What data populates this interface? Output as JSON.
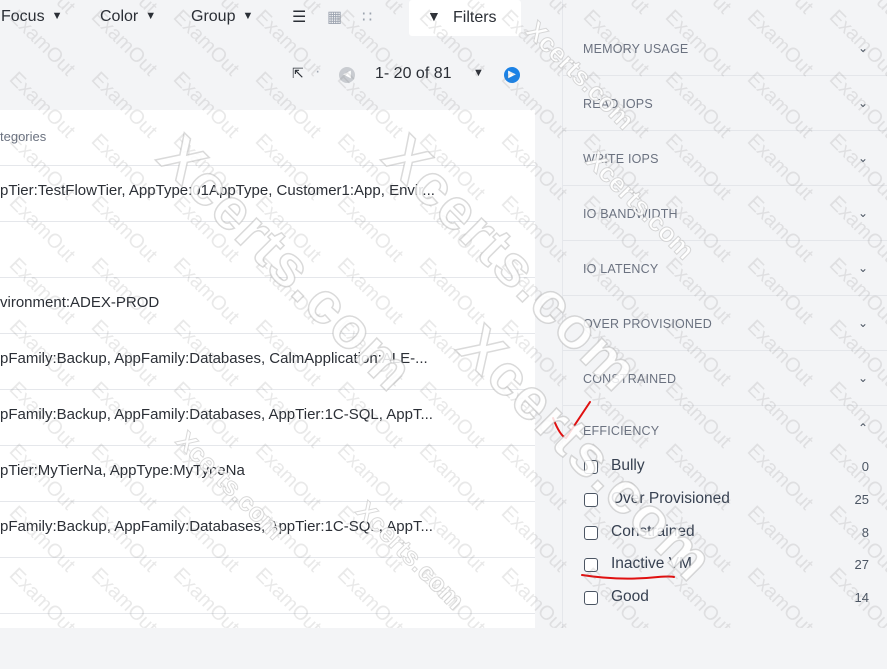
{
  "toolbar": {
    "focus_label": "Focus",
    "color_label": "Color",
    "group_label": "Group",
    "filters_label": "Filters"
  },
  "pagination": {
    "range_label": "1- 20 of 81"
  },
  "table": {
    "column_header": "tegories",
    "rows": [
      "pTier:TestFlowTier, AppType:01AppType, Customer1:App, Envir...",
      "",
      "vironment:ADEX-PROD",
      "pFamily:Backup, AppFamily:Databases, CalmApplication:ALE-...",
      "pFamily:Backup, AppFamily:Databases, AppTier:1C-SQL, AppT...",
      "pTier:MyTierNa, AppType:MyTypeNa",
      "pFamily:Backup, AppFamily:Databases, AppTier:1C-SQL, AppT..."
    ]
  },
  "filter_panel": {
    "sections": [
      "MEMORY USAGE",
      "READ IOPS",
      "WRITE IOPS",
      "IO BANDWIDTH",
      "IO LATENCY",
      "OVER PROVISIONED",
      "CONSTRAINED",
      "EFFICIENCY"
    ],
    "efficiency_options": [
      {
        "label": "Bully",
        "count": "0"
      },
      {
        "label": "Over Provisioned",
        "count": "25"
      },
      {
        "label": "Constrained",
        "count": "8"
      },
      {
        "label": "Inactive VM",
        "count": "27"
      },
      {
        "label": "Good",
        "count": "14"
      }
    ]
  },
  "watermark": {
    "small_text": "ExamOut",
    "large_text": "Xcerts.com"
  },
  "colors": {
    "accent_blue": "#1b82e6",
    "annotation_red": "#e01010"
  }
}
